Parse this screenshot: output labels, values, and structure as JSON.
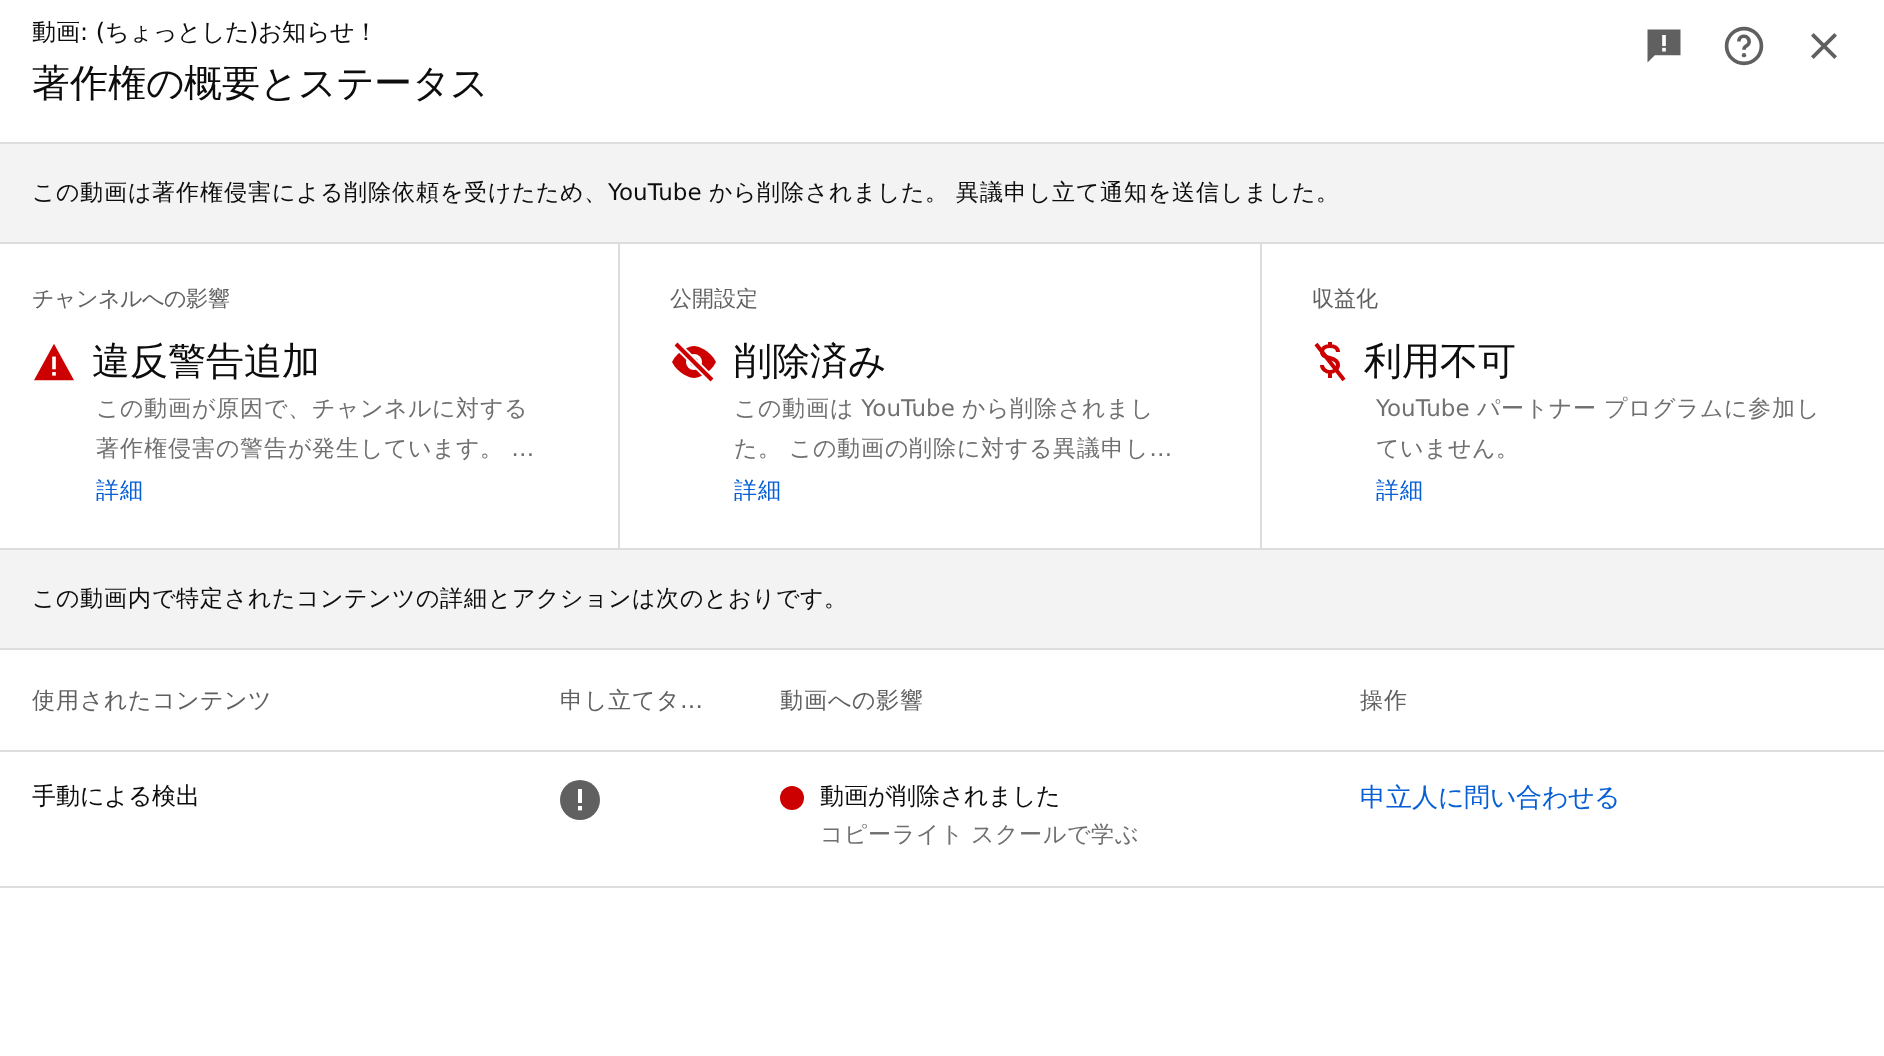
{
  "header": {
    "subtitle": "動画: (ちょっとした)お知らせ！",
    "title": "著作権の概要とステータス"
  },
  "notice": "この動画は著作権侵害による削除依頼を受けたため、YouTube から削除されました。 異議申し立て通知を送信しました。",
  "cards": [
    {
      "kind": "warning",
      "label": "チャンネルへの影響",
      "heading": "違反警告追加",
      "lines": [
        "この動画が原因で、チャンネルに対する",
        "著作権侵害の警告が発生しています。 …"
      ],
      "link": "詳細"
    },
    {
      "kind": "hidden",
      "label": "公開設定",
      "heading": "削除済み",
      "lines": [
        "この動画は YouTube から削除されまし",
        "た。 この動画の削除に対する異議申し…"
      ],
      "link": "詳細"
    },
    {
      "kind": "demonetized",
      "label": "収益化",
      "heading": "利用不可",
      "lines": [
        "YouTube パートナー プログラムに参加し",
        "ていません。"
      ],
      "link": "詳細"
    }
  ],
  "details_notice": "この動画内で特定されたコンテンツの詳細とアクションは次のとおりです。",
  "table": {
    "columns": [
      "使用されたコンテンツ",
      "申し立てタ…",
      "動画への影響",
      "操作"
    ],
    "rows": [
      {
        "content": "手動による検出",
        "impact": "動画が削除されました",
        "impact_link": "コピーライト スクールで学ぶ",
        "action": "申立人に問い合わせる"
      }
    ]
  }
}
